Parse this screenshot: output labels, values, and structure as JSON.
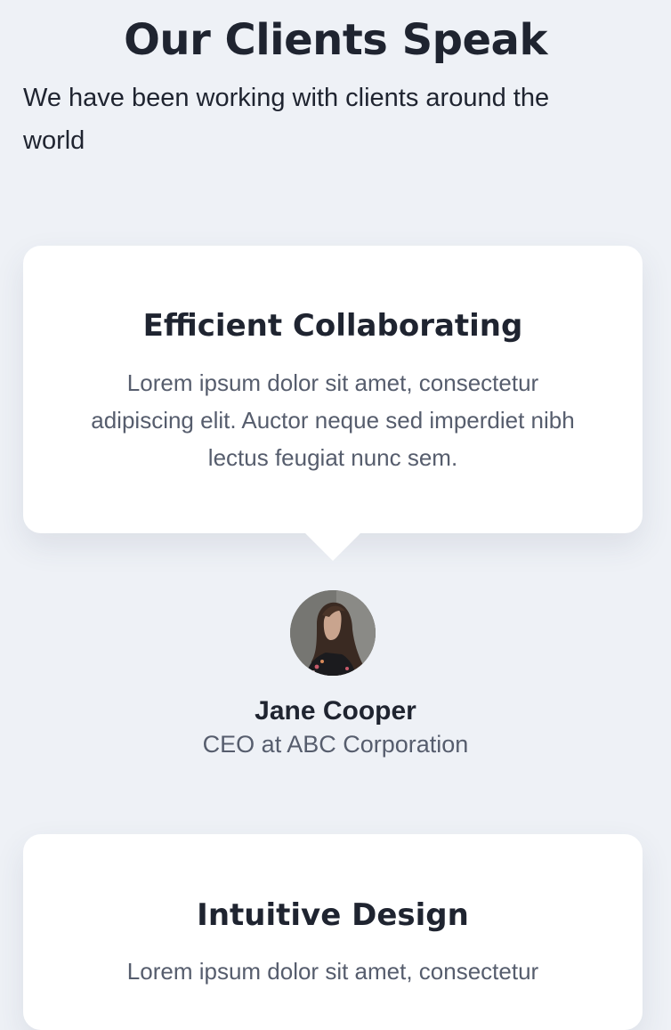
{
  "header": {
    "title": "Our Clients Speak",
    "subtitle": "We have been working with clients around the world"
  },
  "testimonials": [
    {
      "title": "Efficient Collaborating",
      "text": "Lorem ipsum dolor sit amet, consectetur adipiscing elit. Auctor neque sed imperdiet nibh lectus feugiat nunc sem.",
      "author": {
        "name": "Jane Cooper",
        "role": "CEO at ABC Corporation",
        "avatar_icon": "avatar-photo"
      }
    },
    {
      "title": "Intuitive Design",
      "text": "Lorem ipsum dolor sit amet, consectetur"
    }
  ],
  "colors": {
    "background": "#eef1f6",
    "card": "#ffffff",
    "heading": "#1f2430",
    "body_text": "#565d6d"
  }
}
